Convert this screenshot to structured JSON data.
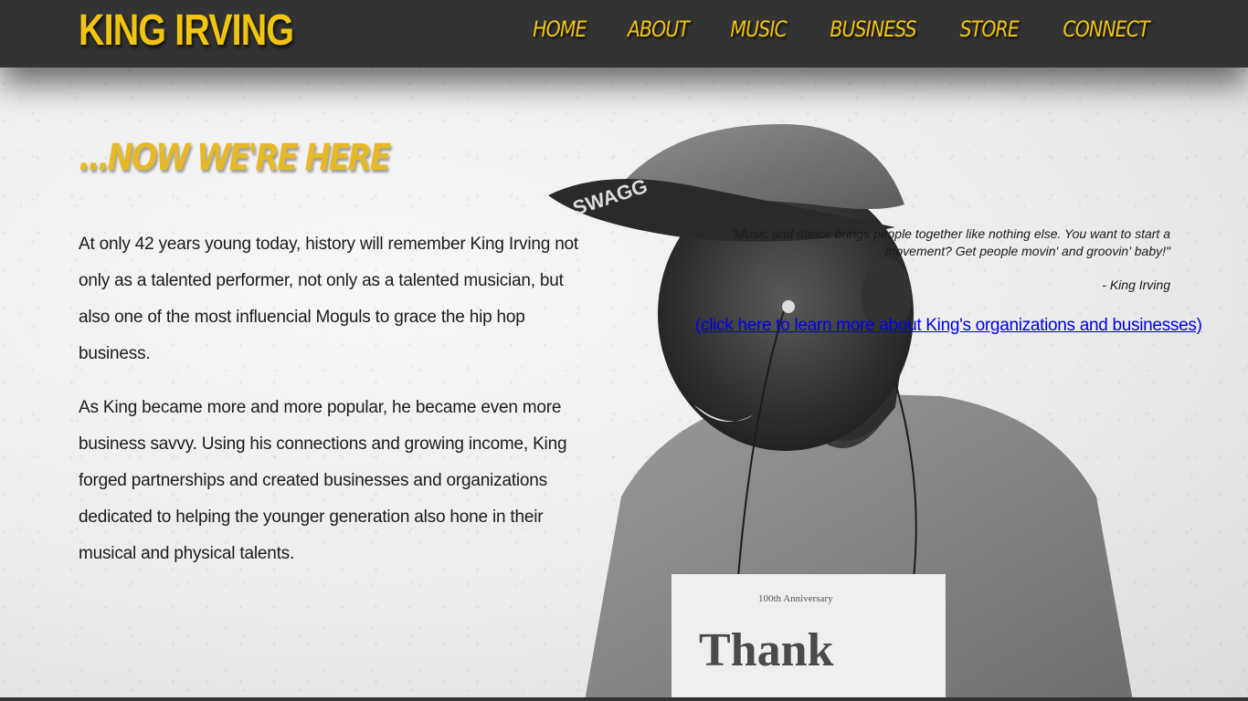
{
  "brand": {
    "title": "KING IRVING"
  },
  "nav": {
    "items": [
      {
        "label": "HOME"
      },
      {
        "label": "ABOUT"
      },
      {
        "label": "MUSIC"
      },
      {
        "label": "BUSINESS"
      },
      {
        "label": "STORE"
      },
      {
        "label": "CONNECT"
      }
    ]
  },
  "section": {
    "heading": "...NOW WE'RE HERE",
    "paragraphs": [
      "At only 42 years young today, history will remember King Irving not only as a talented performer, not only as a talented musician, but also one of the most influencial Moguls to grace the hip hop business.",
      "As King became more and more popular, he became even more business savvy. Using his connections and growing income, King forged partnerships and created businesses and organizations dedicated to helping the younger generation also hone in their musical and physical talents."
    ],
    "quote": "\"Music and dance brings people together like nothing else. You want to start a movement? Get people movin' and groovin' baby!\"",
    "quote_author": "- King Irving",
    "business_link": "(click here to learn more about King's organizations and businesses)"
  },
  "photo": {
    "cap_text": "SWAGG",
    "shirt_badge": "100th Anniversary",
    "shirt_text": "Thank"
  },
  "colors": {
    "header_bg": "#333333",
    "accent_yellow": "#f1c40f",
    "heading_yellow": "#e5b92a",
    "link_blue": "#0000ee",
    "body_text": "#1b1b1b"
  }
}
